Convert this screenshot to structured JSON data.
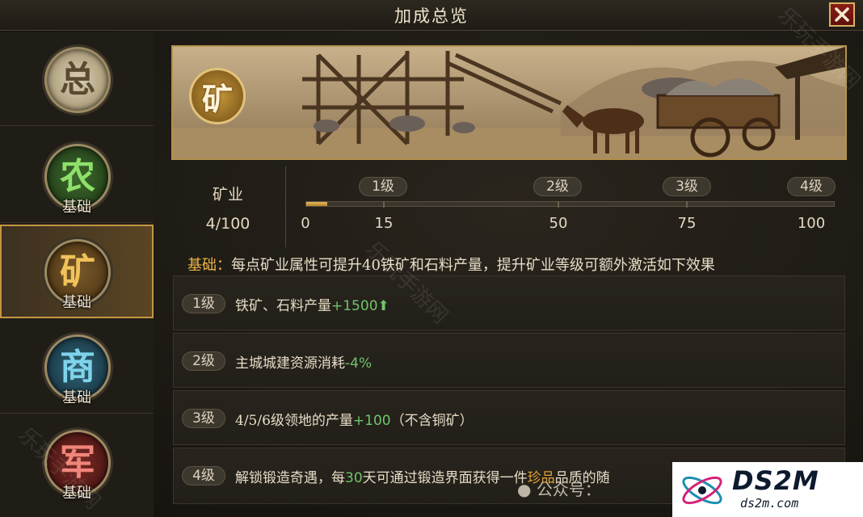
{
  "title": "加成总览",
  "sidebar": {
    "items": [
      {
        "glyph": "总",
        "sub": ""
      },
      {
        "glyph": "农",
        "sub": "基础"
      },
      {
        "glyph": "矿",
        "sub": "基础"
      },
      {
        "glyph": "商",
        "sub": "基础"
      },
      {
        "glyph": "军",
        "sub": "基础"
      }
    ],
    "active_index": 2
  },
  "banner": {
    "badge": "矿"
  },
  "stat": {
    "label": "矿业",
    "value": "4/100",
    "progress_fraction": 0.04
  },
  "levels": [
    "1级",
    "2级",
    "3级",
    "4级"
  ],
  "ticks": [
    "0",
    "15",
    "50",
    "75",
    "100"
  ],
  "description": {
    "key": "基础：",
    "text": "每点矿业属性可提升40铁矿和石料产量，提升矿业等级可额外激活如下效果"
  },
  "effects": [
    {
      "tag": "1级",
      "pre": "铁矿、石料产量",
      "value": "+1500",
      "post": "",
      "arrow": "⬆"
    },
    {
      "tag": "2级",
      "pre": "主城城建资源消耗",
      "value": "-4%",
      "post": "",
      "arrow": ""
    },
    {
      "tag": "3级",
      "pre": "4/5/6级领地的产量",
      "value": "+100",
      "post": "（不含铜矿）",
      "arrow": ""
    },
    {
      "tag": "4级",
      "pre": "解锁锻造奇遇，每",
      "value": "30",
      "post": "天可通过锻造界面获得一件",
      "gold": "珍品",
      "post2": "品质的随"
    }
  ],
  "watermarks": {
    "gzh": "公众号：",
    "logo_main": "DS2M",
    "logo_sub": "ds2m.com",
    "diagonal": "乐玩手游网"
  },
  "colors": {
    "accent_gold": "#eab64b",
    "positive_green": "#6fc56a",
    "close_red": "#8a1d14"
  }
}
